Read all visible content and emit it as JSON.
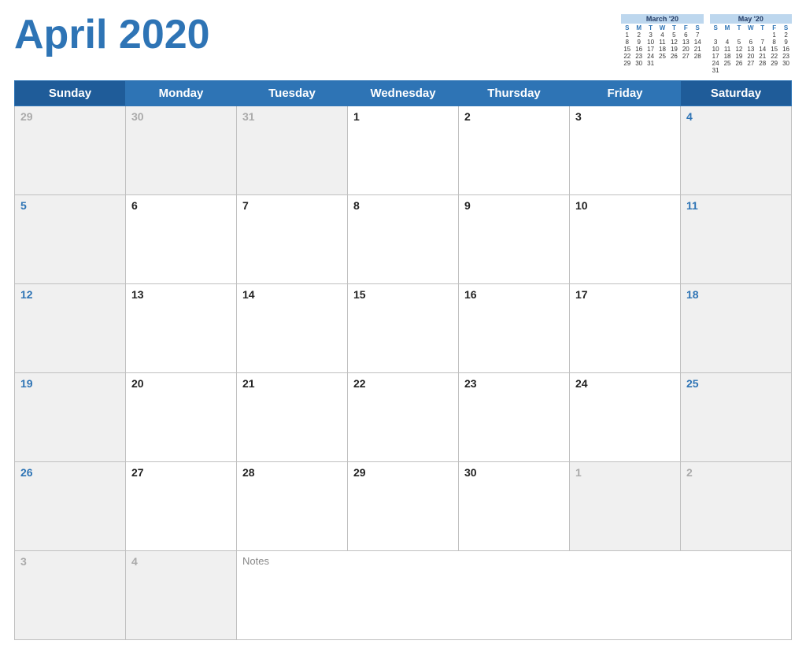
{
  "header": {
    "title": "April 2020"
  },
  "mini_calendars": [
    {
      "title": "March '20",
      "days_header": [
        "S",
        "M",
        "T",
        "W",
        "T",
        "F",
        "S"
      ],
      "weeks": [
        [
          "",
          "",
          "",
          "",
          "",
          "",
          ""
        ],
        [
          "1",
          "2",
          "3",
          "4",
          "5",
          "6",
          "7"
        ],
        [
          "8",
          "9",
          "10",
          "11",
          "12",
          "13",
          "14"
        ],
        [
          "15",
          "16",
          "17",
          "18",
          "19",
          "20",
          "21"
        ],
        [
          "22",
          "23",
          "24",
          "25",
          "26",
          "27",
          "28"
        ],
        [
          "29",
          "30",
          "31",
          "",
          "",
          "",
          ""
        ]
      ]
    },
    {
      "title": "May '20",
      "days_header": [
        "S",
        "M",
        "T",
        "W",
        "T",
        "F",
        "S"
      ],
      "weeks": [
        [
          "",
          "",
          "",
          "",
          "",
          "1",
          "2"
        ],
        [
          "3",
          "4",
          "5",
          "6",
          "7",
          "8",
          "9"
        ],
        [
          "10",
          "11",
          "12",
          "13",
          "14",
          "15",
          "16"
        ],
        [
          "17",
          "18",
          "19",
          "20",
          "21",
          "22",
          "23"
        ],
        [
          "24",
          "25",
          "26",
          "27",
          "28",
          "29",
          "30"
        ],
        [
          "31",
          "",
          "",
          "",
          "",
          "",
          ""
        ]
      ]
    }
  ],
  "weekdays": [
    "Sunday",
    "Monday",
    "Tuesday",
    "Wednesday",
    "Thursday",
    "Friday",
    "Saturday"
  ],
  "weeks": [
    [
      {
        "date": "29",
        "type": "other-month"
      },
      {
        "date": "30",
        "type": "other-month"
      },
      {
        "date": "31",
        "type": "other-month"
      },
      {
        "date": "1",
        "type": "normal"
      },
      {
        "date": "2",
        "type": "normal"
      },
      {
        "date": "3",
        "type": "normal"
      },
      {
        "date": "4",
        "type": "weekend",
        "color": "blue"
      }
    ],
    [
      {
        "date": "5",
        "type": "weekend",
        "color": "blue"
      },
      {
        "date": "6",
        "type": "normal"
      },
      {
        "date": "7",
        "type": "normal"
      },
      {
        "date": "8",
        "type": "normal"
      },
      {
        "date": "9",
        "type": "normal"
      },
      {
        "date": "10",
        "type": "normal"
      },
      {
        "date": "11",
        "type": "weekend",
        "color": "blue"
      }
    ],
    [
      {
        "date": "12",
        "type": "weekend",
        "color": "blue"
      },
      {
        "date": "13",
        "type": "normal"
      },
      {
        "date": "14",
        "type": "normal"
      },
      {
        "date": "15",
        "type": "normal"
      },
      {
        "date": "16",
        "type": "normal"
      },
      {
        "date": "17",
        "type": "normal"
      },
      {
        "date": "18",
        "type": "weekend",
        "color": "blue"
      }
    ],
    [
      {
        "date": "19",
        "type": "weekend",
        "color": "blue"
      },
      {
        "date": "20",
        "type": "normal"
      },
      {
        "date": "21",
        "type": "normal"
      },
      {
        "date": "22",
        "type": "normal"
      },
      {
        "date": "23",
        "type": "normal"
      },
      {
        "date": "24",
        "type": "normal"
      },
      {
        "date": "25",
        "type": "weekend",
        "color": "blue"
      }
    ],
    [
      {
        "date": "26",
        "type": "weekend",
        "color": "blue"
      },
      {
        "date": "27",
        "type": "normal"
      },
      {
        "date": "28",
        "type": "normal"
      },
      {
        "date": "29",
        "type": "normal"
      },
      {
        "date": "30",
        "type": "normal"
      },
      {
        "date": "1",
        "type": "other-month"
      },
      {
        "date": "2",
        "type": "other-month"
      }
    ]
  ],
  "notes_row": [
    {
      "date": "3",
      "type": "other-month"
    },
    {
      "date": "4",
      "type": "other-month"
    },
    {
      "notes": "Notes",
      "colspan": 5
    }
  ],
  "colors": {
    "header_bg": "#2e74b5",
    "weekend_bg": "#1f5c99",
    "blue_text": "#2e74b5",
    "gray_text": "#aaa",
    "other_bg": "#f0f0f0"
  }
}
